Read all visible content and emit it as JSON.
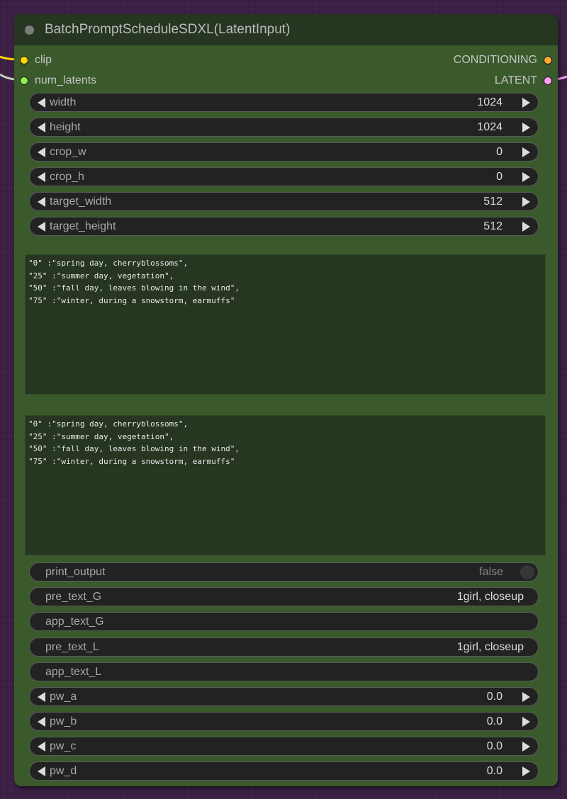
{
  "node": {
    "title": "BatchPromptScheduleSDXL(LatentInput)",
    "colors": {
      "canvas_bg": "#3e2147",
      "node_body": "#3a5a2c",
      "node_header": "#273621",
      "widget_bg": "#222222"
    },
    "inputs": [
      {
        "name": "clip",
        "color": "#ffd500"
      },
      {
        "name": "num_latents",
        "color": "#8ef14f"
      }
    ],
    "outputs": [
      {
        "name": "CONDITIONING",
        "color": "#ffa931"
      },
      {
        "name": "LATENT",
        "color": "#ff9cf9"
      }
    ],
    "number_widgets": [
      {
        "label": "width",
        "value": "1024"
      },
      {
        "label": "height",
        "value": "1024"
      },
      {
        "label": "crop_w",
        "value": "0"
      },
      {
        "label": "crop_h",
        "value": "0"
      },
      {
        "label": "target_width",
        "value": "512"
      },
      {
        "label": "target_height",
        "value": "512"
      }
    ],
    "text_g": "\"0\" :\"spring day, cherryblossoms\",\n\"25\" :\"summer day, vegetation\",\n\"50\" :\"fall day, leaves blowing in the wind\",\n\"75\" :\"winter, during a snowstorm, earmuffs\"",
    "text_l": "\"0\" :\"spring day, cherryblossoms\",\n\"25\" :\"summer day, vegetation\",\n\"50\" :\"fall day, leaves blowing in the wind\",\n\"75\" :\"winter, during a snowstorm, earmuffs\"",
    "print_output": {
      "label": "print_output",
      "value": "false"
    },
    "text_widgets": [
      {
        "label": "pre_text_G",
        "value": "1girl, closeup"
      },
      {
        "label": "app_text_G",
        "value": ""
      },
      {
        "label": "pre_text_L",
        "value": "1girl, closeup"
      },
      {
        "label": "app_text_L",
        "value": ""
      }
    ],
    "pw_widgets": [
      {
        "label": "pw_a",
        "value": "0.0"
      },
      {
        "label": "pw_b",
        "value": "0.0"
      },
      {
        "label": "pw_c",
        "value": "0.0"
      },
      {
        "label": "pw_d",
        "value": "0.0"
      }
    ]
  }
}
